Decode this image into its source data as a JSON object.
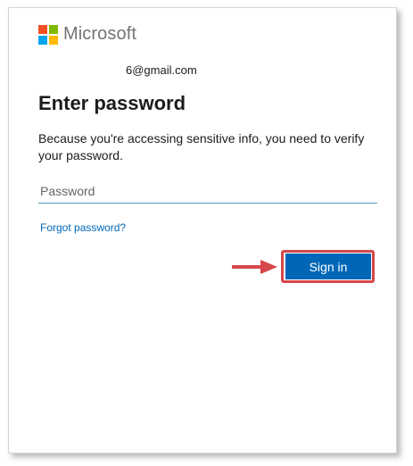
{
  "brand": {
    "name": "Microsoft",
    "logo_colors": [
      "#f25022",
      "#7fba00",
      "#00a4ef",
      "#ffb900"
    ]
  },
  "identity": {
    "email": "6@gmail.com"
  },
  "heading": "Enter password",
  "description": "Because you're accessing sensitive info, you need to verify your password.",
  "password_field": {
    "placeholder": "Password",
    "value": ""
  },
  "forgot_link": "Forgot password?",
  "signin_button": "Sign in",
  "colors": {
    "accent": "#0067b8",
    "annotation": "#d6474b"
  }
}
